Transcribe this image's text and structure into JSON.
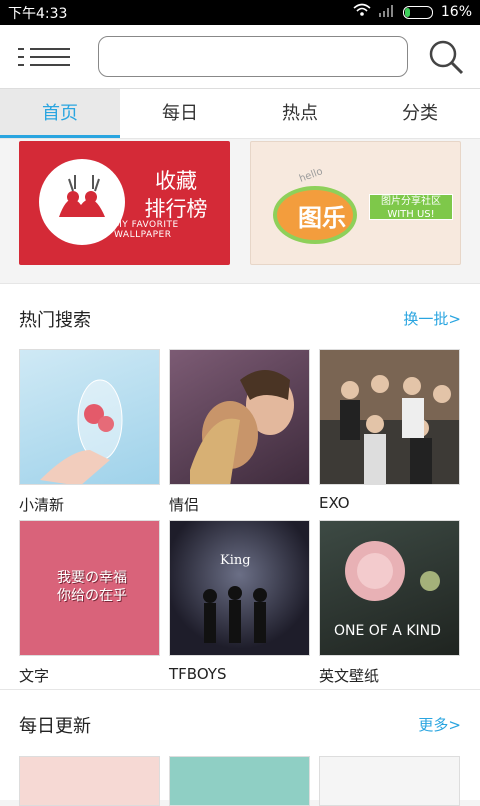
{
  "status_bar": {
    "time": "下午4:33",
    "battery": "16%"
  },
  "tabs": [
    {
      "label": "首页",
      "active": true
    },
    {
      "label": "每日",
      "active": false
    },
    {
      "label": "热点",
      "active": false
    },
    {
      "label": "分类",
      "active": false
    }
  ],
  "banners": {
    "left": {
      "title": "收藏\n排行榜",
      "subtitle": "MY FAVORITE WALLPAPER"
    },
    "right": {
      "hello": "hello",
      "title": "图乐",
      "ribbon": "图片分享社区\nWITH US!"
    }
  },
  "hot_search": {
    "title": "热门搜索",
    "link": "换一批>",
    "items": [
      {
        "label": "小清新"
      },
      {
        "label": "情侣"
      },
      {
        "label": "EXO"
      },
      {
        "label": "文字",
        "overlay": "我要の幸福 你给の在乎"
      },
      {
        "label": "TFBOYS",
        "overlay": "King"
      },
      {
        "label": "英文壁纸",
        "overlay": "ONE OF A KIND"
      }
    ]
  },
  "daily_update": {
    "title": "每日更新",
    "link": "更多>"
  }
}
